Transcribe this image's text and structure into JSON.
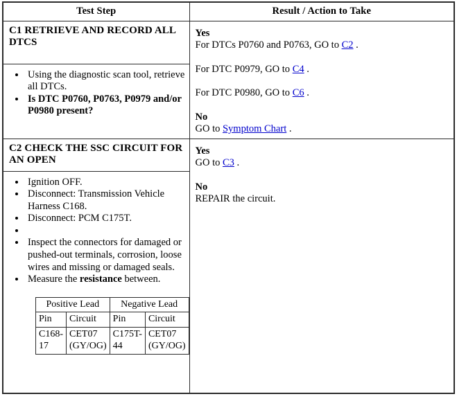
{
  "table": {
    "headers": {
      "test_step": "Test Step",
      "result_action": "Result / Action to Take"
    },
    "steps": [
      {
        "id": "C1",
        "title": "C1 RETRIEVE AND RECORD ALL DTCS",
        "bullets": [
          {
            "text": "Using the diagnostic scan tool, retrieve all DTCs.",
            "bold": false
          },
          {
            "text": "Is DTC P0760, P0763, P0979 and/or P0980 present?",
            "bold": true
          }
        ],
        "result": {
          "yes_label": "Yes",
          "yes_lines": [
            {
              "pre": "For DTCs P0760 and P0763, GO to ",
              "link": "C2",
              "post": " ."
            },
            {
              "pre": "For DTC P0979, GO to ",
              "link": "C4",
              "post": " ."
            },
            {
              "pre": "For DTC P0980, GO to ",
              "link": "C6",
              "post": " ."
            }
          ],
          "no_label": "No",
          "no_lines": [
            {
              "pre": "GO to ",
              "link": "Symptom Chart",
              "post": " ."
            }
          ]
        }
      },
      {
        "id": "C2",
        "title": "C2 CHECK THE SSC CIRCUIT FOR AN OPEN",
        "bullets": [
          {
            "text": "Ignition OFF.",
            "bold": false
          },
          {
            "text": "Disconnect: Transmission Vehicle Harness C168.",
            "bold": false
          },
          {
            "text": "Disconnect: PCM C175T.",
            "bold": false
          },
          {
            "text": "",
            "bold": false
          },
          {
            "text": "Inspect the connectors for damaged or pushed-out terminals, corrosion, loose wires and missing or damaged seals.",
            "bold": false
          },
          {
            "text": "Measure the resistance between.",
            "bold": false,
            "bold_word": "resistance"
          }
        ],
        "lead_table": {
          "group_headers": [
            "Positive Lead",
            "Negative Lead"
          ],
          "column_headers": [
            "Pin",
            "Circuit",
            "Pin",
            "Circuit"
          ],
          "rows": [
            [
              "C168-17",
              "CET07 (GY/OG)",
              "C175T-44",
              "CET07 (GY/OG)"
            ]
          ]
        },
        "result": {
          "yes_label": "Yes",
          "yes_lines": [
            {
              "pre": "GO to ",
              "link": "C3",
              "post": " ."
            }
          ],
          "no_label": "No",
          "no_lines": [
            {
              "pre": "REPAIR the circuit.",
              "link": "",
              "post": ""
            }
          ]
        }
      }
    ]
  },
  "colors": {
    "link": "#0000CC",
    "border": "#2B2B2B",
    "text": "#000000",
    "background": "#FFFFFF"
  }
}
